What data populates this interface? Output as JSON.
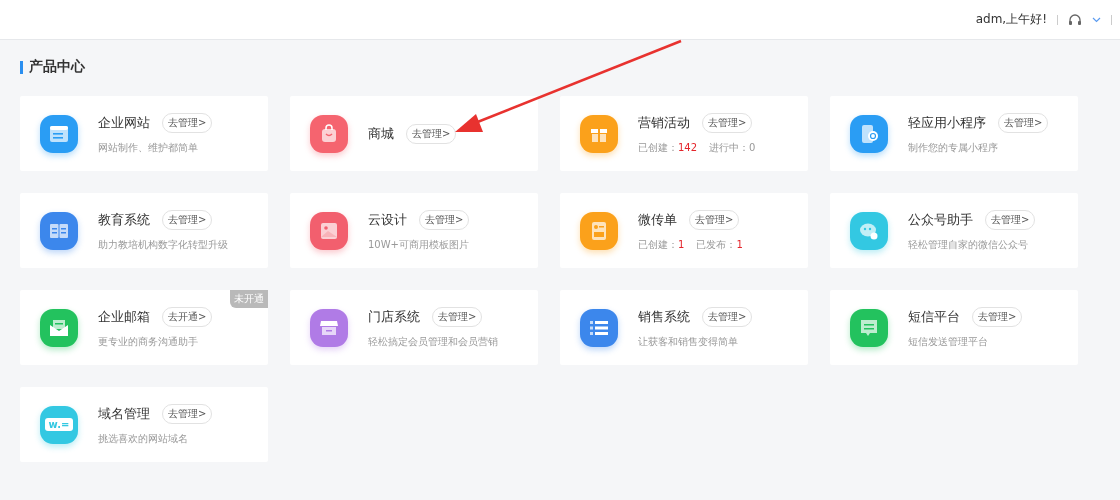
{
  "header": {
    "greeting": "adm,上午好!"
  },
  "section": {
    "title": "产品中心"
  },
  "products": [
    {
      "name": "企业网站",
      "action": "去管理>",
      "color": "#2a9df4",
      "kind": "desc",
      "desc": "网站制作、维护都简单"
    },
    {
      "name": "商城",
      "action": "去管理>",
      "color": "#f5646f",
      "kind": "plain"
    },
    {
      "name": "营销活动",
      "action": "去管理>",
      "color": "#fba11b",
      "kind": "stats",
      "stats": [
        {
          "label": "已创建：",
          "value": "142",
          "highlight": true
        },
        {
          "label": "进行中：",
          "value": "0",
          "highlight": false
        }
      ]
    },
    {
      "name": "轻应用小程序",
      "action": "去管理>",
      "color": "#2a9df4",
      "kind": "desc",
      "desc": "制作您的专属小程序"
    },
    {
      "name": "教育系统",
      "action": "去管理>",
      "color": "#3c87ec",
      "kind": "desc",
      "desc": "助力教培机构数字化转型升级"
    },
    {
      "name": "云设计",
      "action": "去管理>",
      "color": "#f25f6e",
      "kind": "desc",
      "desc": "10W+可商用模板图片"
    },
    {
      "name": "微传单",
      "action": "去管理>",
      "color": "#fba11b",
      "kind": "stats",
      "stats": [
        {
          "label": "已创建：",
          "value": "1",
          "highlight": true
        },
        {
          "label": "已发布：",
          "value": "1",
          "highlight": true
        }
      ]
    },
    {
      "name": "公众号助手",
      "action": "去管理>",
      "color": "#33c8e2",
      "kind": "desc",
      "desc": "轻松管理自家的微信公众号"
    },
    {
      "name": "企业邮箱",
      "action": "去开通>",
      "color": "#23c25e",
      "kind": "desc",
      "desc": "更专业的商务沟通助手",
      "badge": "未开通"
    },
    {
      "name": "门店系统",
      "action": "去管理>",
      "color": "#b07be6",
      "kind": "desc",
      "desc": "轻松搞定会员管理和会员营销"
    },
    {
      "name": "销售系统",
      "action": "去管理>",
      "color": "#3c87ec",
      "kind": "desc",
      "desc": "让获客和销售变得简单"
    },
    {
      "name": "短信平台",
      "action": "去管理>",
      "color": "#23c25e",
      "kind": "desc",
      "desc": "短信发送管理平台"
    },
    {
      "name": "域名管理",
      "action": "去管理>",
      "color": "#33c8e2",
      "kind": "desc",
      "desc": "挑选喜欢的网站域名",
      "icon_text": "w.="
    }
  ]
}
